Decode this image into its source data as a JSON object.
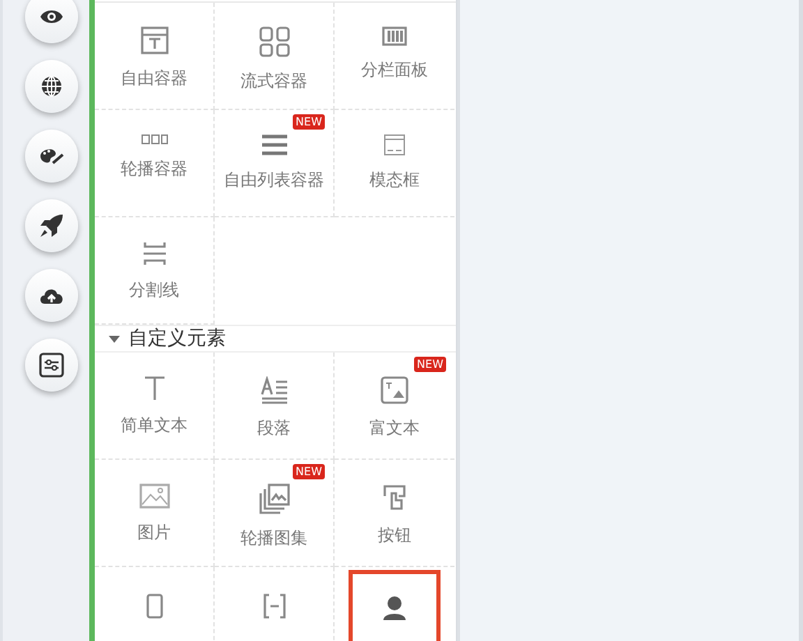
{
  "rail": {
    "buttons": [
      {
        "selected": false
      },
      {
        "selected": false
      },
      {
        "selected": false
      },
      {
        "selected": false
      },
      {
        "selected": false
      },
      {
        "selected": false
      }
    ]
  },
  "layout_section": {
    "items": [
      {
        "label": "自由容器"
      },
      {
        "label": "流式容器"
      },
      {
        "label": "分栏面板"
      },
      {
        "label": "轮播容器"
      },
      {
        "label": "自由列表容器",
        "badge": "NEW"
      },
      {
        "label": "模态框"
      },
      {
        "label": "分割线"
      }
    ]
  },
  "custom_section": {
    "title": "自定义元素",
    "expanded": true,
    "items": [
      {
        "label": "简单文本",
        "highlighted": false
      },
      {
        "label": "段落",
        "highlighted": false
      },
      {
        "label": "富文本",
        "badge": "NEW",
        "highlighted": false
      },
      {
        "label": "图片",
        "highlighted": false
      },
      {
        "label": "轮播图集",
        "badge": "NEW",
        "highlighted": false
      },
      {
        "label": "按钮",
        "highlighted": false
      },
      {
        "highlighted": false
      },
      {
        "highlighted": false
      },
      {
        "highlighted": true
      }
    ]
  }
}
